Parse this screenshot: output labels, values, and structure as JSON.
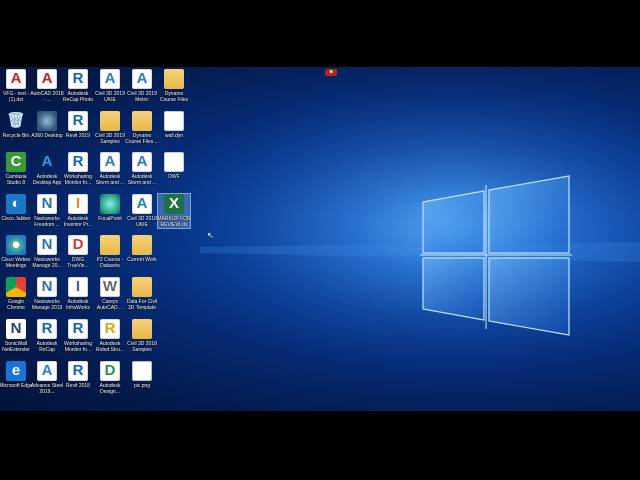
{
  "desktop": {
    "icons": [
      {
        "label": "VFG - test - (1).dst",
        "glyph": "A",
        "style": "autocad",
        "icon": "autocad-icon",
        "col": 0,
        "row": 0
      },
      {
        "label": "Recycle Bin",
        "glyph": "🗑",
        "style": "bin",
        "icon": "recycle-bin-icon",
        "col": 0,
        "row": 1
      },
      {
        "label": "Camtasia Studio 8",
        "glyph": "C",
        "style": "camtasia",
        "icon": "camtasia-icon",
        "col": 0,
        "row": 2
      },
      {
        "label": "Cisco Jabber",
        "glyph": "◐",
        "style": "jabber",
        "icon": "cisco-jabber-icon",
        "col": 0,
        "row": 3
      },
      {
        "label": "Cisco Webex Meetings",
        "glyph": "●",
        "style": "webex",
        "icon": "cisco-webex-icon",
        "col": 0,
        "row": 4
      },
      {
        "label": "Google Chrome",
        "glyph": "",
        "style": "chrome",
        "icon": "chrome-icon",
        "col": 0,
        "row": 5
      },
      {
        "label": "SonicWall NetExtender",
        "glyph": "N",
        "style": "sonicwall",
        "icon": "sonicwall-icon",
        "col": 0,
        "row": 6
      },
      {
        "label": "Microsoft Edge",
        "glyph": "e",
        "style": "edge",
        "icon": "edge-icon",
        "col": 0,
        "row": 7
      },
      {
        "label": "AutoCAD 2018 - ...",
        "glyph": "A",
        "style": "autocad",
        "icon": "autocad-icon",
        "col": 1,
        "row": 0
      },
      {
        "label": "A360 Desktop",
        "glyph": "",
        "style": "a360",
        "icon": "a360-icon",
        "col": 1,
        "row": 1
      },
      {
        "label": "Autodesk Desktop App",
        "glyph": "A",
        "style": "desktopapp",
        "icon": "autodesk-app-icon",
        "col": 1,
        "row": 2
      },
      {
        "label": "Navisworks Freedom ...",
        "glyph": "N",
        "style": "naviswork",
        "icon": "navisworks-icon",
        "col": 1,
        "row": 3
      },
      {
        "label": "Navisworks Manage 20...",
        "glyph": "N",
        "style": "naviswork",
        "icon": "navisworks-icon",
        "col": 1,
        "row": 4
      },
      {
        "label": "Navisworks Manage 2019",
        "glyph": "N",
        "style": "naviswork",
        "icon": "navisworks-icon",
        "col": 1,
        "row": 5
      },
      {
        "label": "Autodesk ReCap",
        "glyph": "R",
        "style": "revit",
        "icon": "recap-icon",
        "col": 1,
        "row": 6
      },
      {
        "label": "Advance Steel 2019...",
        "glyph": "A",
        "style": "civil",
        "icon": "advance-steel-icon",
        "col": 1,
        "row": 7
      },
      {
        "label": "Autodesk ReCap Photo",
        "glyph": "R",
        "style": "revit",
        "icon": "recap-photo-icon",
        "col": 2,
        "row": 0
      },
      {
        "label": "Revit 2019",
        "glyph": "R",
        "style": "revit",
        "icon": "revit-icon",
        "col": 2,
        "row": 1
      },
      {
        "label": "Worksharing Monitor fo...",
        "glyph": "R",
        "style": "revit",
        "icon": "revit-icon",
        "col": 2,
        "row": 2
      },
      {
        "label": "Autodesk Inventor Pr...",
        "glyph": "I",
        "style": "insight",
        "icon": "inventor-icon",
        "col": 2,
        "row": 3
      },
      {
        "label": "DWG TrueVie...",
        "glyph": "D",
        "style": "dwg",
        "icon": "dwg-trueview-icon",
        "col": 2,
        "row": 4
      },
      {
        "label": "Autodesk InfraWorks",
        "glyph": "I",
        "style": "infra",
        "icon": "infraworks-icon",
        "col": 2,
        "row": 5
      },
      {
        "label": "Worksharing Monitor fo...",
        "glyph": "R",
        "style": "revit",
        "icon": "revit-icon",
        "col": 2,
        "row": 6
      },
      {
        "label": "Revit 2018",
        "glyph": "R",
        "style": "revit",
        "icon": "revit-icon",
        "col": 2,
        "row": 7
      },
      {
        "label": "Civil 3D 2019 UKIE",
        "glyph": "A",
        "style": "civil",
        "icon": "civil3d-icon",
        "col": 3,
        "row": 0
      },
      {
        "label": "Civil 3D 2019 Samples",
        "glyph": "",
        "style": "folder",
        "icon": "folder-icon",
        "col": 3,
        "row": 1
      },
      {
        "label": "Autodesk Storm and ...",
        "glyph": "A",
        "style": "civil",
        "icon": "storm-icon",
        "col": 3,
        "row": 2
      },
      {
        "label": "FocalPoint",
        "glyph": "",
        "style": "focuspoint",
        "icon": "focalpoint-icon",
        "col": 3,
        "row": 3
      },
      {
        "label": "P2 Course - Datasets",
        "glyph": "",
        "style": "folder",
        "icon": "folder-icon",
        "col": 3,
        "row": 4
      },
      {
        "label": "Careys AutoCAD ...",
        "glyph": "W",
        "style": "doc",
        "icon": "word-doc-icon",
        "col": 3,
        "row": 5
      },
      {
        "label": "Autodesk Robot Stru...",
        "glyph": "R",
        "style": "robot",
        "icon": "robot-icon",
        "col": 3,
        "row": 6
      },
      {
        "label": "Autodesk Design...",
        "glyph": "D",
        "style": "design",
        "icon": "design-icon",
        "col": 3,
        "row": 7
      },
      {
        "label": "Civil 3D 2019 Metric",
        "glyph": "A",
        "style": "civil",
        "icon": "civil3d-icon",
        "col": 4,
        "row": 0
      },
      {
        "label": "Dynamo Course Files ...",
        "glyph": "",
        "style": "folder",
        "icon": "folder-icon",
        "col": 4,
        "row": 1
      },
      {
        "label": "Autodesk Storm and ...",
        "glyph": "A",
        "style": "civil",
        "icon": "storm-icon",
        "col": 4,
        "row": 2
      },
      {
        "label": "Civil 3D 2018 UKIE",
        "glyph": "A",
        "style": "civil",
        "icon": "civil3d-icon",
        "col": 4,
        "row": 3
      },
      {
        "label": "Current Work",
        "glyph": "",
        "style": "folder",
        "icon": "folder-icon",
        "col": 4,
        "row": 4
      },
      {
        "label": "Data For Civil 3D Template",
        "glyph": "",
        "style": "folder",
        "icon": "folder-icon",
        "col": 4,
        "row": 5
      },
      {
        "label": "Civil 3D 2018 Samples",
        "glyph": "",
        "style": "folder",
        "icon": "folder-icon",
        "col": 4,
        "row": 6
      },
      {
        "label": "pic.png",
        "glyph": "",
        "style": "pic",
        "icon": "image-file-icon",
        "col": 4,
        "row": 7
      },
      {
        "label": "Dynamo Course Files",
        "glyph": "",
        "style": "folder",
        "icon": "folder-icon",
        "col": 5,
        "row": 0
      },
      {
        "label": "wall.dyn",
        "glyph": "",
        "style": "doc",
        "icon": "file-icon",
        "col": 5,
        "row": 1
      },
      {
        "label": "DWF",
        "glyph": "",
        "style": "dwf",
        "icon": "dwf-file-icon",
        "col": 5,
        "row": 2
      },
      {
        "label": "MARKUP FOR REVIEW.xls",
        "glyph": "X",
        "style": "excel",
        "icon": "excel-icon",
        "col": 5,
        "row": 3,
        "selected": true
      }
    ]
  },
  "top_badge": {
    "label": "■"
  }
}
